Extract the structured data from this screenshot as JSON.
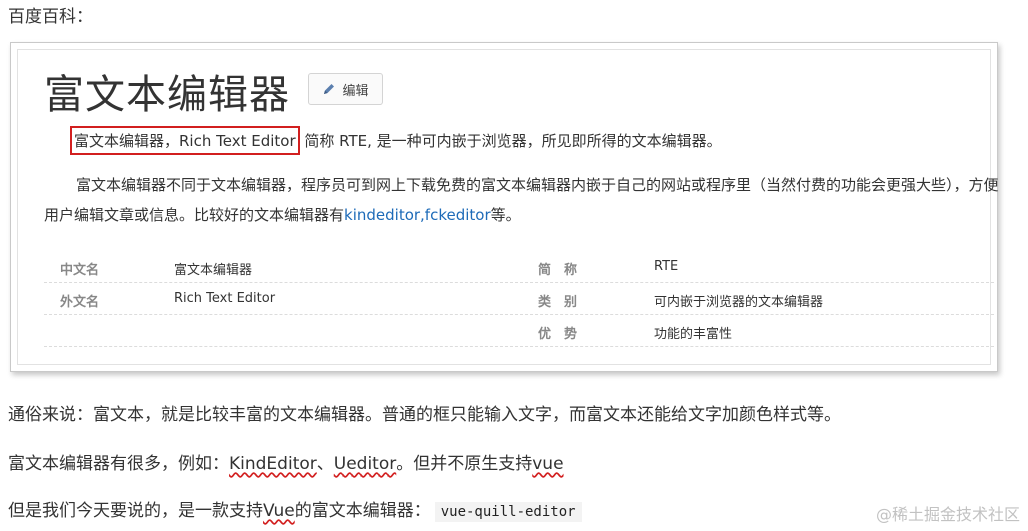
{
  "intro": "百度百科：",
  "card": {
    "title": "富文本编辑器",
    "edit_label": "编辑",
    "edit_icon": "pencil-icon",
    "p1_highlight": "富文本编辑器，Rich Text Editor",
    "p1_rest": " 简称 RTE, 是一种可内嵌于浏览器，所见即所得的文本编辑器。",
    "p2_before": "富文本编辑器不同于文本编辑器，程序员可到网上下载免费的富文本编辑器内嵌于自己的网站或程序里（当然付费的功能会更强大些），方便用户编辑文章或信息。比较好的文本编辑器有",
    "p2_link": "kindeditor,fckeditor",
    "p2_after": "等。",
    "info_rows": [
      {
        "k1": "中文名",
        "v1": "富文本编辑器",
        "k2": "简称",
        "v2": "RTE"
      },
      {
        "k1": "外文名",
        "v1": "Rich Text Editor",
        "k2": "类别",
        "v2": "可内嵌于浏览器的文本编辑器"
      },
      {
        "k1": "",
        "v1": "",
        "k2": "优势",
        "v2": "功能的丰富性"
      }
    ]
  },
  "text1": "通俗来说：富文本，就是比较丰富的文本编辑器。普通的框只能输入文字，而富文本还能给文字加颜色样式等。",
  "text2": {
    "before": "富文本编辑器有很多，例如：",
    "kind": "KindEditor",
    "sep": "、",
    "ueditor": "Ueditor",
    "mid": "。但并不原生支持",
    "vue": "vue"
  },
  "text3": {
    "before": "但是我们今天要说的，是一款支持",
    "vue": "Vue",
    "after": "的富文本编辑器：",
    "code": "vue-quill-editor"
  },
  "watermark": "@稀土掘金技术社区",
  "colors": {
    "accent_red": "#d21f1f",
    "link_blue": "#1e6bb8"
  }
}
